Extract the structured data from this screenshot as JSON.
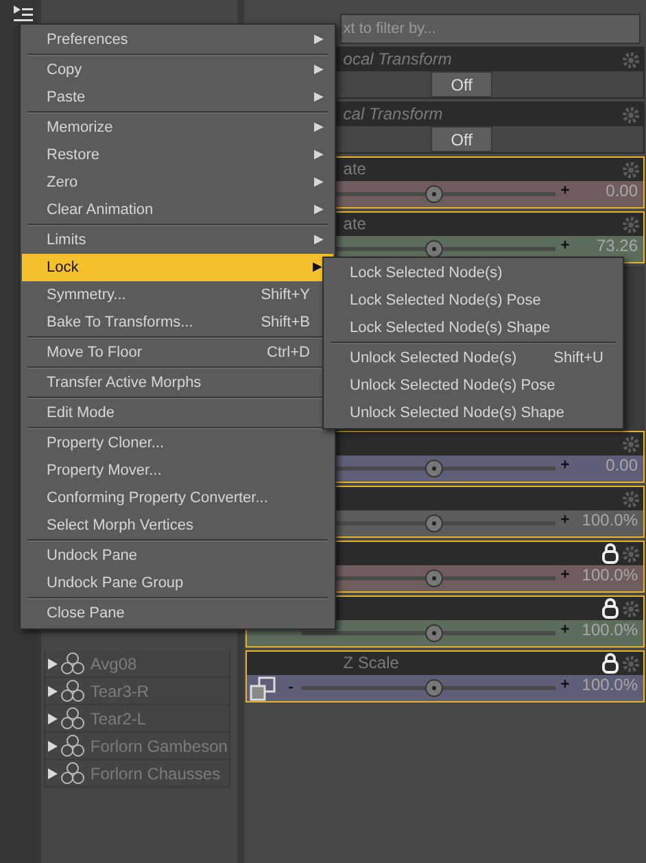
{
  "scene_panel": {
    "items": [
      {
        "label": "Avg08",
        "expanded": false
      },
      {
        "label": "Tear3-R",
        "expanded": false
      },
      {
        "label": "Tear2-L",
        "expanded": false
      },
      {
        "label": "Forlorn Gambeson",
        "expanded": false
      },
      {
        "label": "Forlorn Chausses",
        "expanded": false
      }
    ]
  },
  "parameters_panel": {
    "filter": {
      "placeholder": "xt to filter by..."
    },
    "properties": [
      {
        "kind": "toggle",
        "label": "ocal Transform",
        "value": "Off",
        "selected": false
      },
      {
        "kind": "toggle",
        "label": "cal Transform",
        "value": "Off",
        "selected": false
      },
      {
        "kind": "slider",
        "label": "ate",
        "color": "#6f5d5d",
        "level": 0.52,
        "increment": "+",
        "value": "0.00",
        "locked": false,
        "selected": true
      },
      {
        "kind": "slider",
        "label": "ate",
        "color": "#5d6d5d",
        "level": 0.52,
        "increment": "+",
        "value": "73.26",
        "locked": false,
        "selected": true
      },
      {
        "kind": "slider",
        "color": "#5e5e78",
        "level": 0.52,
        "increment": "+",
        "value": "0.00",
        "locked": false,
        "selected": true
      },
      {
        "kind": "slider",
        "color": "#5c5c5c",
        "level": 0.52,
        "increment": "+",
        "value": "100.0%",
        "locked": false,
        "selected": true
      },
      {
        "kind": "slider",
        "color": "#6f5d5d",
        "level": 0.52,
        "increment": "+",
        "value": "100.0%",
        "locked": true,
        "selected": true
      },
      {
        "kind": "slider",
        "color": "#5d6d5d",
        "level": 0.52,
        "increment": "+",
        "value": "100.0%",
        "locked": true,
        "selected": true
      },
      {
        "kind": "slider",
        "label": "Z Scale",
        "color": "#5e5e78",
        "level": 0.52,
        "decrement": "-",
        "increment": "+",
        "value": "100.0%",
        "locked": true,
        "selected": true
      }
    ]
  },
  "context_menu": {
    "items": [
      {
        "kind": "item",
        "label": "Preferences",
        "arrow": "▶",
        "selected": false
      },
      {
        "kind": "separator"
      },
      {
        "kind": "item",
        "label": "Copy",
        "arrow": "▶",
        "selected": false
      },
      {
        "kind": "item",
        "label": "Paste",
        "arrow": "▶",
        "selected": false
      },
      {
        "kind": "separator"
      },
      {
        "kind": "item",
        "label": "Memorize",
        "arrow": "▶",
        "selected": false
      },
      {
        "kind": "item",
        "label": "Restore",
        "arrow": "▶",
        "selected": false
      },
      {
        "kind": "item",
        "label": "Zero",
        "arrow": "▶",
        "selected": false
      },
      {
        "kind": "item",
        "label": "Clear Animation",
        "arrow": "▶",
        "selected": false
      },
      {
        "kind": "separator"
      },
      {
        "kind": "item",
        "label": "Limits",
        "arrow": "▶",
        "selected": false
      },
      {
        "kind": "item",
        "label": "Lock",
        "arrow": "▶",
        "selected": true,
        "submenu": {
          "items": [
            {
              "kind": "item",
              "label": "Lock Selected Node(s)"
            },
            {
              "kind": "item",
              "label": "Lock Selected Node(s) Pose"
            },
            {
              "kind": "item",
              "label": "Lock Selected Node(s) Shape"
            },
            {
              "kind": "separator"
            },
            {
              "kind": "item",
              "label": "Unlock Selected Node(s)",
              "shortcut": "Shift+U"
            },
            {
              "kind": "item",
              "label": "Unlock Selected Node(s) Pose"
            },
            {
              "kind": "item",
              "label": "Unlock Selected Node(s) Shape"
            }
          ]
        }
      },
      {
        "kind": "item",
        "label": "Symmetry...",
        "shortcut": "Shift+Y",
        "selected": false
      },
      {
        "kind": "item",
        "label": "Bake To Transforms...",
        "shortcut": "Shift+B",
        "selected": false
      },
      {
        "kind": "separator"
      },
      {
        "kind": "item",
        "label": "Move To Floor",
        "shortcut": "Ctrl+D",
        "selected": false
      },
      {
        "kind": "separator"
      },
      {
        "kind": "item",
        "label": "Transfer Active Morphs",
        "selected": false
      },
      {
        "kind": "separator"
      },
      {
        "kind": "item",
        "label": "Edit Mode",
        "selected": false
      },
      {
        "kind": "separator"
      },
      {
        "kind": "item",
        "label": "Property Cloner...",
        "selected": false
      },
      {
        "kind": "item",
        "label": "Property Mover...",
        "selected": false
      },
      {
        "kind": "item",
        "label": "Conforming Property Converter...",
        "selected": false
      },
      {
        "kind": "item",
        "label": "Select Morph Vertices",
        "selected": false
      },
      {
        "kind": "separator"
      },
      {
        "kind": "item",
        "label": "Undock Pane",
        "selected": false
      },
      {
        "kind": "item",
        "label": "Undock Pane Group",
        "selected": false
      },
      {
        "kind": "separator"
      },
      {
        "kind": "item",
        "label": "Close Pane",
        "selected": false
      }
    ]
  }
}
